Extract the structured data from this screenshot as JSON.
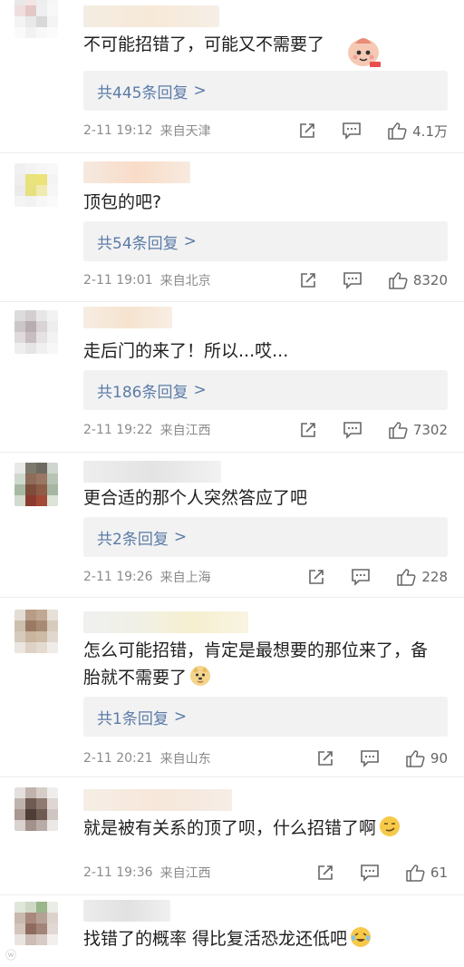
{
  "comments": [
    {
      "text": "不可能招错了，可能又不需要了",
      "replies": "共445条回复",
      "time": "2-11 19:12",
      "location": "来自天津",
      "likes": "4.1万"
    },
    {
      "text": "顶包的吧?",
      "replies": "共54条回复",
      "time": "2-11 19:01",
      "location": "来自北京",
      "likes": "8320"
    },
    {
      "text": "走后门的来了！所以...哎...",
      "replies": "共186条回复",
      "time": "2-11 19:22",
      "location": "来自江西",
      "likes": "7302"
    },
    {
      "text": "更合适的那个人突然答应了吧",
      "replies": "共2条回复",
      "time": "2-11 19:26",
      "location": "来自上海",
      "likes": "228"
    },
    {
      "text_line1": "怎么可能招错，肯定是最想要的那位来了，备",
      "text_line2": "胎就不需要了",
      "replies": "共1条回复",
      "time": "2-11 20:21",
      "location": "来自山东",
      "likes": "90"
    },
    {
      "text": "就是被有关系的顶了呗，什么招错了啊",
      "time": "2-11 19:36",
      "location": "来自江西",
      "likes": "61"
    },
    {
      "text": "找错了的概率 得比复活恐龙还低吧"
    }
  ],
  "ui": {
    "reply_chevron": ">"
  },
  "icons": {
    "share": "share-icon",
    "comment": "comment-icon",
    "like": "thumbs-up-icon"
  },
  "colors": {
    "link": "#5b7ba8",
    "meta": "#8b8b8b",
    "reply_bg": "#f2f2f2"
  }
}
